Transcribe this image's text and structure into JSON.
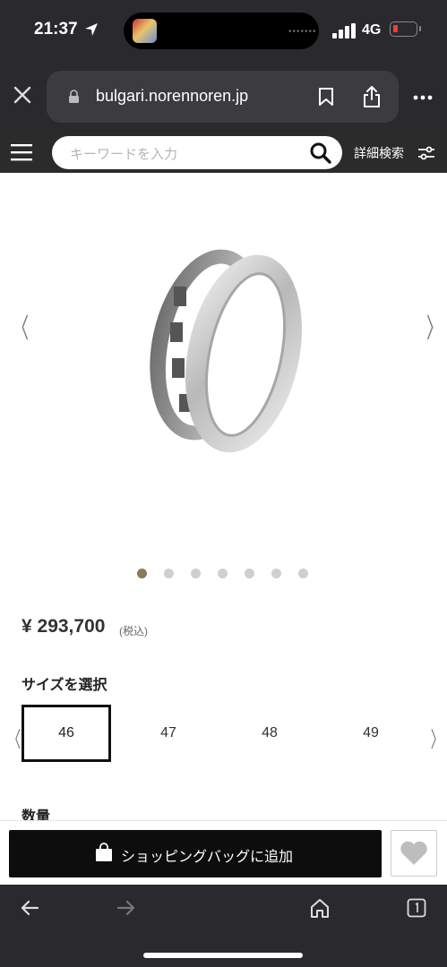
{
  "status": {
    "time": "21:37",
    "network": "4G",
    "island_dots": "•••••••"
  },
  "browser": {
    "url": "bulgari.norennoren.jp"
  },
  "site": {
    "search_placeholder": "キーワードを入力",
    "advanced_search_label": "詳細検索"
  },
  "gallery": {
    "image_count": 7,
    "active_index": 0
  },
  "product": {
    "price": "¥ 293,700",
    "tax_note": "(税込)"
  },
  "size": {
    "label": "サイズを選択",
    "options": [
      "46",
      "47",
      "48",
      "49"
    ],
    "selected": "46"
  },
  "quantity": {
    "label": "数量"
  },
  "actions": {
    "add_to_bag_label": "ショッピングバッグに追加"
  },
  "colors": {
    "accent_dot": "#8a7a55",
    "button_bg": "#0d0d0d",
    "chrome_bg": "#2a2a2e"
  }
}
